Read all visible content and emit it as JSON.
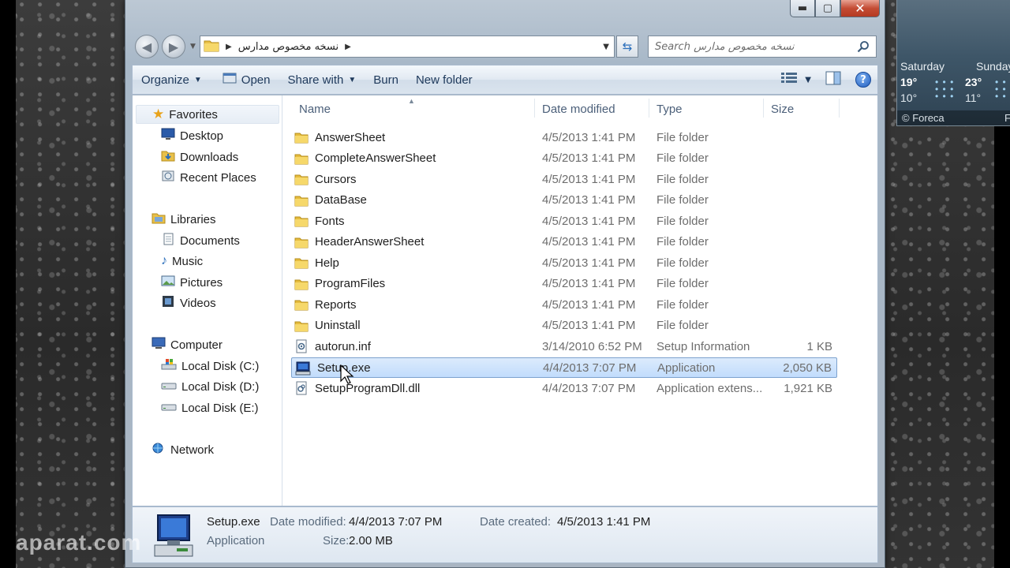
{
  "window": {
    "caption_buttons": {
      "minimize": "▬",
      "maximize": "▢",
      "close": "✕"
    },
    "address": {
      "path": "نسخه مخصوص مدارس"
    },
    "search": {
      "placeholder": "Search نسخه مخصوص مدارس"
    }
  },
  "toolbar": {
    "organize": "Organize",
    "open": "Open",
    "share_with": "Share with",
    "burn": "Burn",
    "new_folder": "New folder"
  },
  "nav_pane": {
    "favorites": "Favorites",
    "desktop": "Desktop",
    "downloads": "Downloads",
    "recent_places": "Recent Places",
    "libraries": "Libraries",
    "documents": "Documents",
    "music": "Music",
    "pictures": "Pictures",
    "videos": "Videos",
    "computer": "Computer",
    "disk_c": "Local Disk (C:)",
    "disk_d": "Local Disk (D:)",
    "disk_e": "Local Disk (E:)",
    "network": "Network"
  },
  "columns": {
    "name": "Name",
    "date": "Date modified",
    "type": "Type",
    "size": "Size"
  },
  "files": [
    {
      "name": "AnswerSheet",
      "date": "4/5/2013 1:41 PM",
      "type": "File folder",
      "size": ""
    },
    {
      "name": "CompleteAnswerSheet",
      "date": "4/5/2013 1:41 PM",
      "type": "File folder",
      "size": ""
    },
    {
      "name": "Cursors",
      "date": "4/5/2013 1:41 PM",
      "type": "File folder",
      "size": ""
    },
    {
      "name": "DataBase",
      "date": "4/5/2013 1:41 PM",
      "type": "File folder",
      "size": ""
    },
    {
      "name": "Fonts",
      "date": "4/5/2013 1:41 PM",
      "type": "File folder",
      "size": ""
    },
    {
      "name": "HeaderAnswerSheet",
      "date": "4/5/2013 1:41 PM",
      "type": "File folder",
      "size": ""
    },
    {
      "name": "Help",
      "date": "4/5/2013 1:41 PM",
      "type": "File folder",
      "size": ""
    },
    {
      "name": "ProgramFiles",
      "date": "4/5/2013 1:41 PM",
      "type": "File folder",
      "size": ""
    },
    {
      "name": "Reports",
      "date": "4/5/2013 1:41 PM",
      "type": "File folder",
      "size": ""
    },
    {
      "name": "Uninstall",
      "date": "4/5/2013 1:41 PM",
      "type": "File folder",
      "size": ""
    },
    {
      "name": "autorun.inf",
      "date": "3/14/2010 6:52 PM",
      "type": "Setup Information",
      "size": "1 KB"
    },
    {
      "name": "Setup.exe",
      "date": "4/4/2013 7:07 PM",
      "type": "Application",
      "size": "2,050 KB"
    },
    {
      "name": "SetupProgramDll.dll",
      "date": "4/4/2013 7:07 PM",
      "type": "Application extens...",
      "size": "1,921 KB"
    }
  ],
  "details": {
    "name": "Setup.exe",
    "kind": "Application",
    "date_modified_label": "Date modified:",
    "date_modified": "4/4/2013 7:07 PM",
    "date_created_label": "Date created:",
    "date_created": "4/5/2013 1:41 PM",
    "size_label": "Size:",
    "size": "2.00 MB"
  },
  "weather": {
    "day1": "Saturday",
    "day1_hi": "19°",
    "day1_lo": "10°",
    "day2": "Sunday",
    "day2_hi": "23°",
    "day2_lo": "11°",
    "source": "© Foreca",
    "edge_letter": "F"
  },
  "watermark": "aparat.com"
}
